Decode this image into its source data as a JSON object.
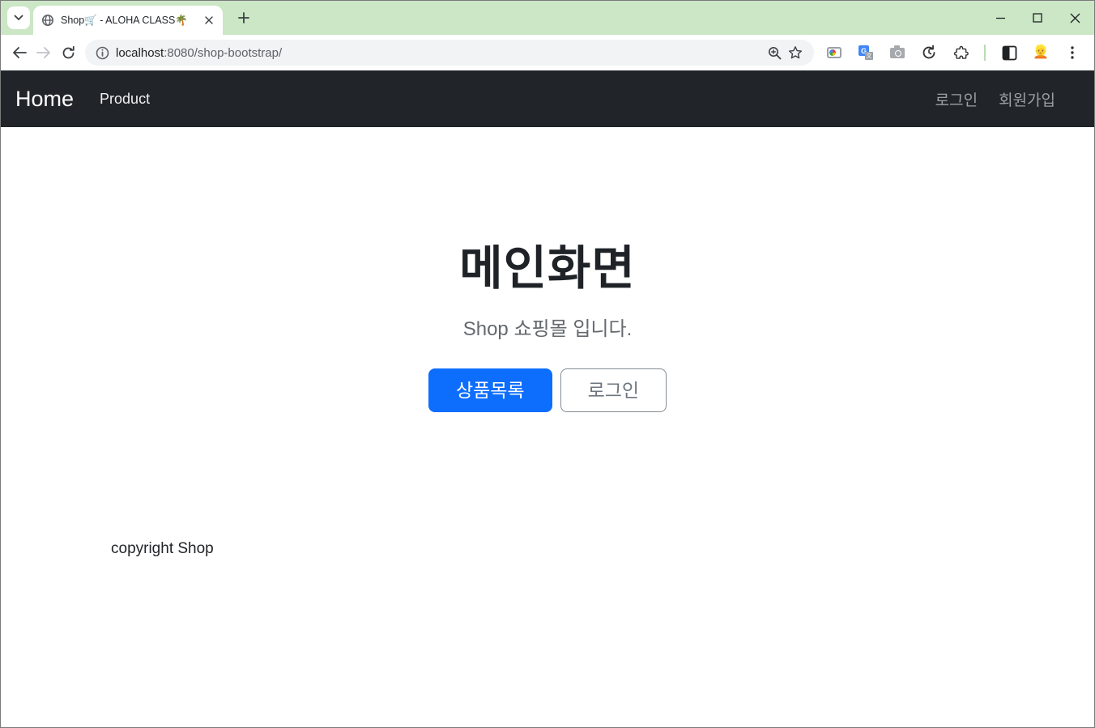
{
  "browser": {
    "tab": {
      "title": "Shop🛒 - ALOHA CLASS🌴"
    },
    "url": {
      "host": "localhost",
      "path": ":8080/shop-bootstrap/"
    }
  },
  "navbar": {
    "brand": "Home",
    "links": [
      {
        "label": "Product"
      }
    ],
    "right_links": [
      {
        "label": "로그인"
      },
      {
        "label": "회원가입"
      }
    ]
  },
  "hero": {
    "title": "메인화면",
    "subtitle": "Shop 쇼핑몰 입니다.",
    "primary_button": "상품목록",
    "secondary_button": "로그인"
  },
  "footer": {
    "text": "copyright Shop"
  },
  "colors": {
    "accent": "#0d6efd",
    "navbar_bg": "#212529",
    "tabstrip_bg": "#cbe7c6",
    "muted_text": "#6c757d"
  }
}
